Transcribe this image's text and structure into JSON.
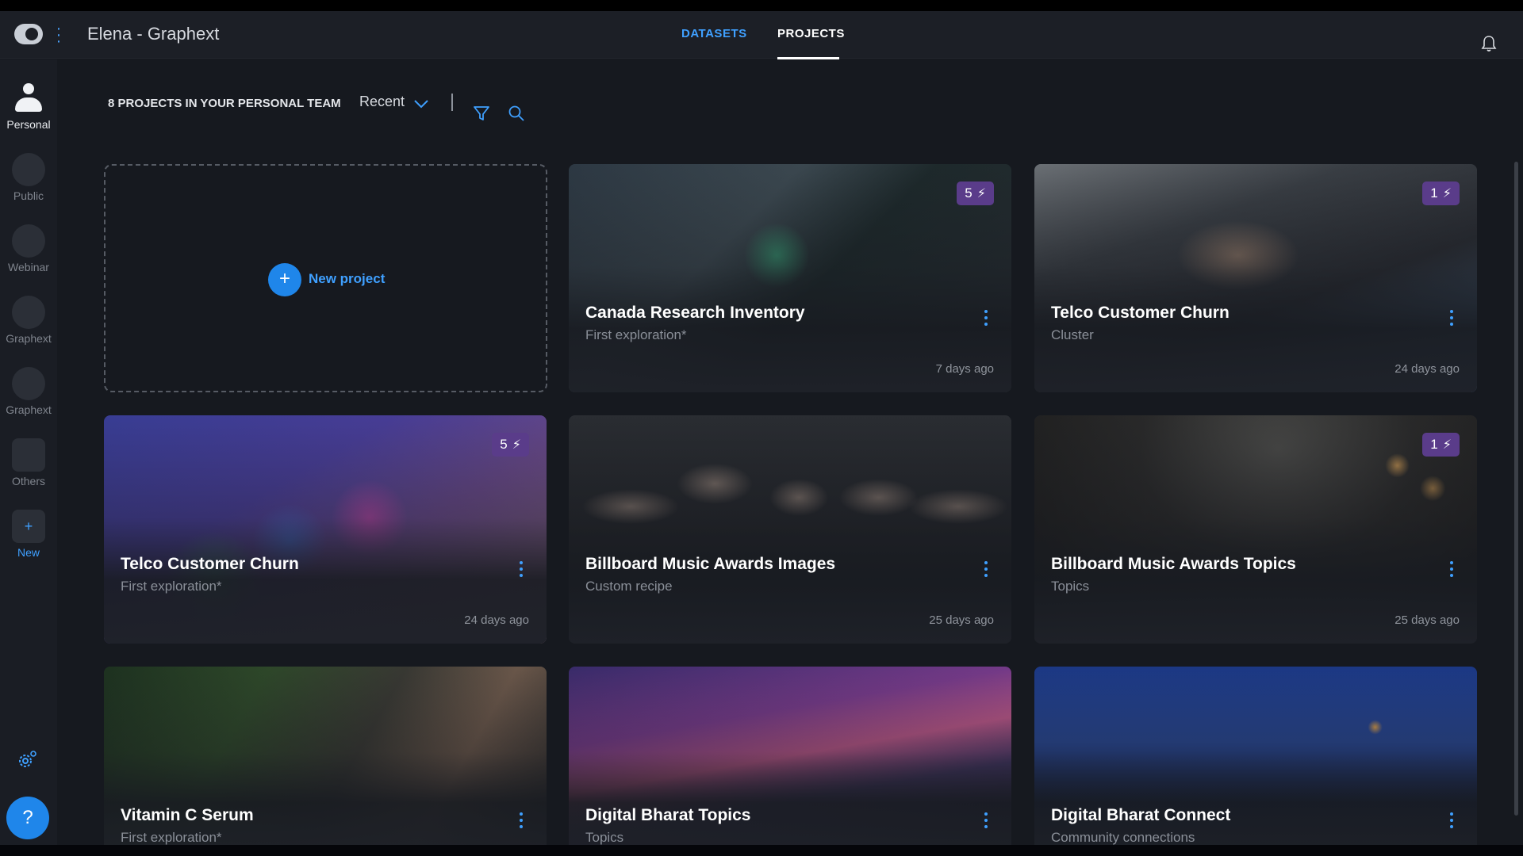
{
  "header": {
    "workspace_title": "Elena - Graphext",
    "tabs": [
      {
        "label": "DATASETS",
        "active": false
      },
      {
        "label": "PROJECTS",
        "active": true
      }
    ]
  },
  "sidebar": {
    "items": [
      {
        "label": "Personal",
        "active": true
      },
      {
        "label": "Public",
        "active": false
      },
      {
        "label": "Webinar",
        "active": false
      },
      {
        "label": "Graphext",
        "active": false
      },
      {
        "label": "Graphext",
        "active": false
      },
      {
        "label": "Others",
        "active": false
      },
      {
        "label": "New",
        "active": false
      }
    ],
    "help_label": "?"
  },
  "toolbar": {
    "count_label": "8 PROJECTS IN YOUR PERSONAL TEAM",
    "sort_value": "Recent"
  },
  "new_project": {
    "plus": "+",
    "label": "New project"
  },
  "projects": [
    {
      "title": "Canada Research Inventory",
      "subtitle": "First exploration*",
      "date": "7 days ago",
      "badge": "5"
    },
    {
      "title": "Telco Customer Churn",
      "subtitle": "Cluster",
      "date": "24 days ago",
      "badge": "1"
    },
    {
      "title": "Telco Customer Churn",
      "subtitle": "First exploration*",
      "date": "24 days ago",
      "badge": "5"
    },
    {
      "title": "Billboard Music Awards Images",
      "subtitle": "Custom recipe",
      "date": "25 days ago",
      "badge": ""
    },
    {
      "title": "Billboard Music Awards Topics",
      "subtitle": "Topics",
      "date": "25 days ago",
      "badge": "1"
    },
    {
      "title": "Vitamin C Serum",
      "subtitle": "First exploration*",
      "date": "",
      "badge": ""
    },
    {
      "title": "Digital Bharat Topics",
      "subtitle": "Topics",
      "date": "",
      "badge": ""
    },
    {
      "title": "Digital Bharat Connect",
      "subtitle": "Community connections",
      "date": "",
      "badge": ""
    }
  ],
  "colors": {
    "accent": "#3fa0ff",
    "badge": "#5a3c8a",
    "background": "#16191f"
  }
}
